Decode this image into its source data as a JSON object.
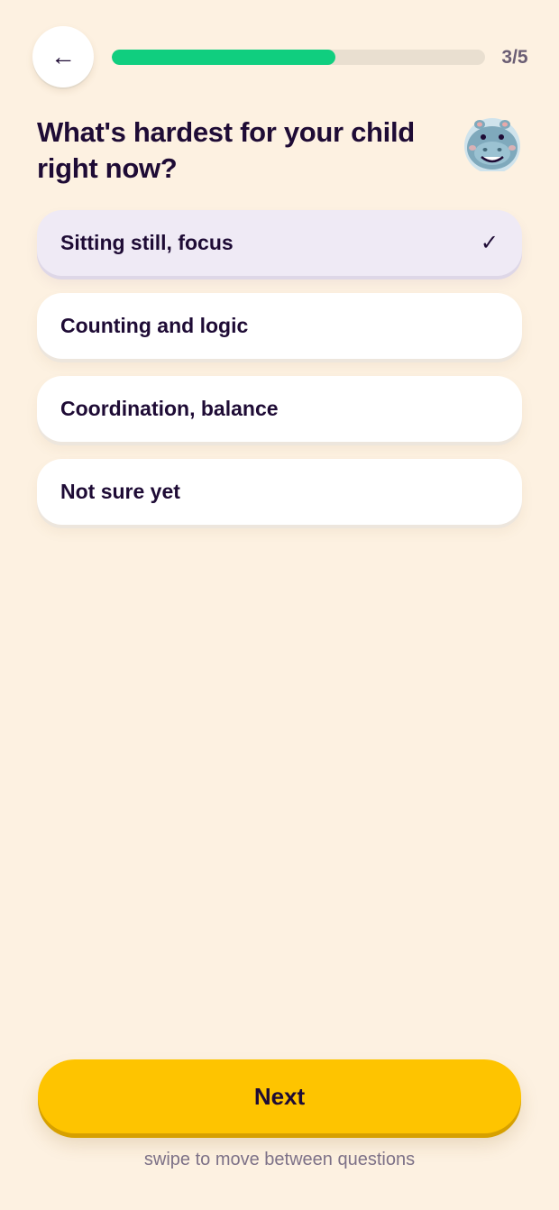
{
  "header": {
    "back_icon": "left-arrow-icon",
    "back_glyph": "←",
    "progress_fraction": 0.6,
    "step_counter": "3/5",
    "progress_color": "#10CE7F",
    "track_color": "#E9DFD0"
  },
  "question": {
    "title": "What's hardest for your child right now?",
    "mascot_icon": "hippo-mascot-icon"
  },
  "options": [
    {
      "label": "Sitting still, focus",
      "selected": true,
      "check": "✓"
    },
    {
      "label": "Counting and logic",
      "selected": false,
      "check": ""
    },
    {
      "label": "Coordination, balance",
      "selected": false,
      "check": ""
    },
    {
      "label": "Not sure yet",
      "selected": false,
      "check": ""
    }
  ],
  "footer": {
    "next_label": "Next",
    "next_color": "#FEC400",
    "hint": "swipe to move between questions"
  }
}
